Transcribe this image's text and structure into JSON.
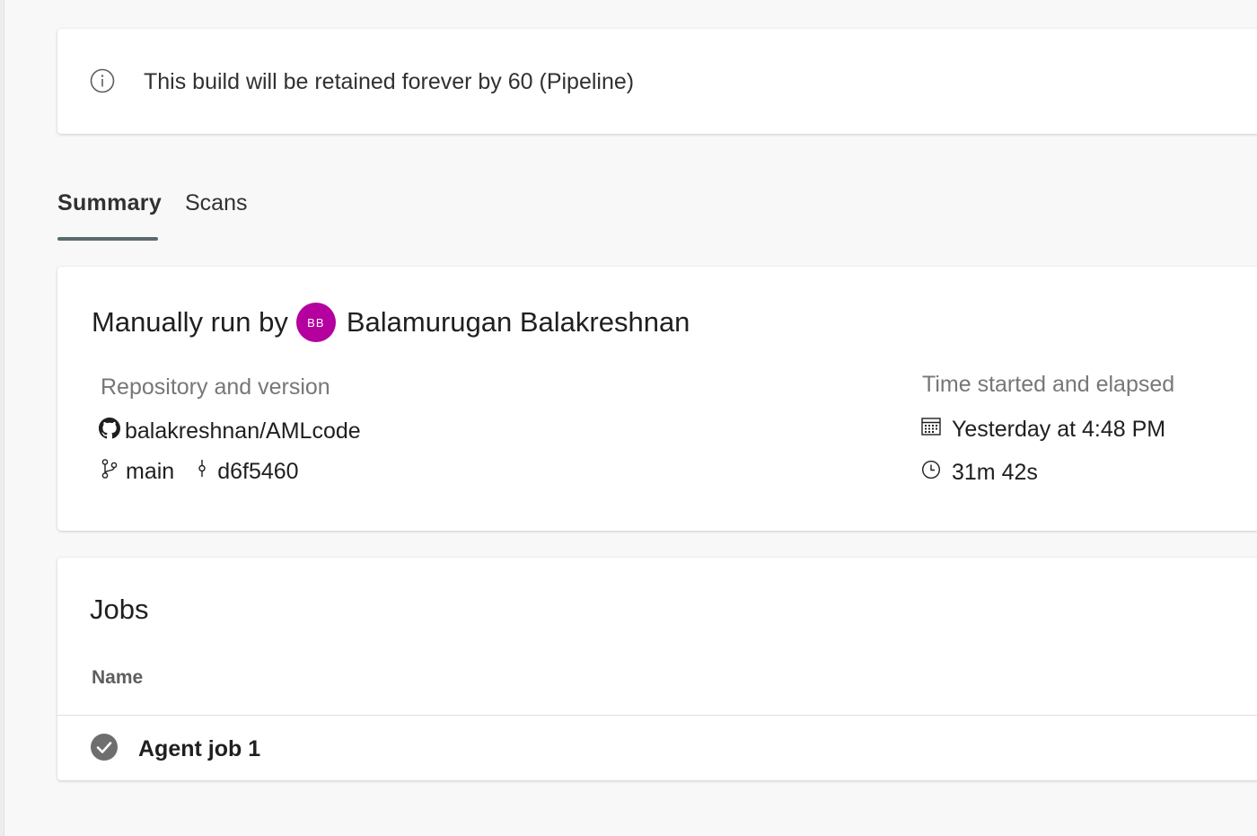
{
  "banner": {
    "icon": "info-icon",
    "text": "This build will be retained forever by 60 (Pipeline)"
  },
  "tabs": [
    {
      "label": "Summary",
      "selected": true
    },
    {
      "label": "Scans",
      "selected": false
    }
  ],
  "summary": {
    "heading_prefix": "Manually run by",
    "user": {
      "initials": "BB",
      "name": "Balamurugan Balakreshnan",
      "avatar_color": "#b4009e"
    },
    "repository": {
      "label": "Repository and version",
      "icon": "github-icon",
      "name": "balakreshnan/AMLcode",
      "branch_icon": "branch-icon",
      "branch": "main",
      "commit_icon": "commit-icon",
      "commit": "d6f5460"
    },
    "time": {
      "label": "Time started and elapsed",
      "calendar_icon": "calendar-icon",
      "started": "Yesterday at 4:48 PM",
      "clock_icon": "clock-icon",
      "elapsed": "31m 42s"
    }
  },
  "jobs": {
    "title": "Jobs",
    "column_header": "Name",
    "items": [
      {
        "name": "Agent job 1",
        "status": "succeeded",
        "status_icon": "check-circle-icon"
      }
    ]
  },
  "colors": {
    "background": "#f8f8f8",
    "card": "#ffffff",
    "tab_indicator": "#5a6b6e",
    "avatar": "#b4009e",
    "status_success": "#6e6e6e"
  }
}
